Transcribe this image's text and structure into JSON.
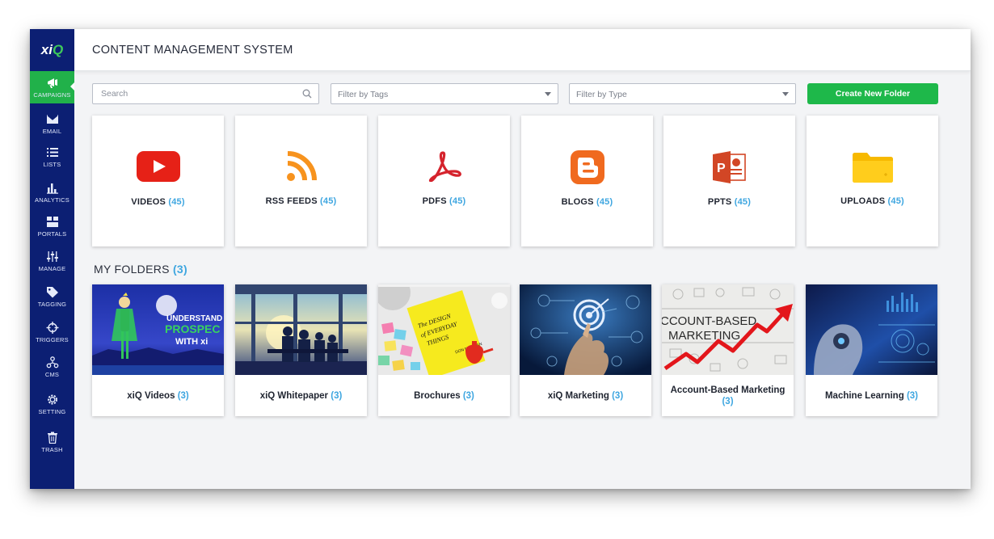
{
  "brand": {
    "logo_main": "xi",
    "logo_accent": "Q",
    "accent_color": "#21b14a",
    "sidebar_color": "#0c1f73"
  },
  "sidebar": {
    "items": [
      {
        "label": "CAMPAIGNS",
        "icon": "megaphone-icon",
        "active": true
      },
      {
        "label": "EMAIL",
        "icon": "envelope-icon"
      },
      {
        "label": "LISTS",
        "icon": "list-icon"
      },
      {
        "label": "ANALYTICS",
        "icon": "bar-chart-icon"
      },
      {
        "label": "PORTALS",
        "icon": "grid-icon"
      },
      {
        "label": "MANAGE",
        "icon": "sliders-icon"
      },
      {
        "label": "TAGGING",
        "icon": "tag-icon"
      },
      {
        "label": "TRIGGERS",
        "icon": "crosshair-icon"
      },
      {
        "label": "CMS",
        "icon": "hierarchy-icon"
      },
      {
        "label": "SETTING",
        "icon": "gear-icon"
      },
      {
        "label": "TRASH",
        "icon": "trash-icon"
      }
    ]
  },
  "header": {
    "title": "CONTENT MANAGEMENT SYSTEM"
  },
  "toolbar": {
    "search_placeholder": "Search",
    "filter_tags": "Filter by Tags",
    "filter_type": "Filter by Type",
    "create_label": "Create New Folder"
  },
  "content_types": [
    {
      "name": "VIDEOS",
      "count": "(45)",
      "icon": "youtube-icon"
    },
    {
      "name": "RSS FEEDS",
      "count": "(45)",
      "icon": "rss-icon"
    },
    {
      "name": "PDFS",
      "count": "(45)",
      "icon": "pdf-icon"
    },
    {
      "name": "BLOGS",
      "count": "(45)",
      "icon": "blogger-icon"
    },
    {
      "name": "PPTS",
      "count": "(45)",
      "icon": "powerpoint-icon"
    },
    {
      "name": "UPLOADS",
      "count": "(45)",
      "icon": "folder-icon"
    }
  ],
  "my_folders": {
    "title": "MY FOLDERS",
    "count": "(3)",
    "folders": [
      {
        "name": "xiQ Videos",
        "count": "(3)",
        "thumb_text_1": "UNDERSTAND YO",
        "thumb_text_2": "PROSPEC",
        "thumb_text_3": "WITH xi"
      },
      {
        "name": "xiQ Whitepaper",
        "count": "(3)"
      },
      {
        "name": "Brochures",
        "count": "(3)",
        "thumb_text_1": "The DESIGN",
        "thumb_text_2": "of EVERYDAY",
        "thumb_text_3": "THINGS",
        "thumb_text_4": "DON NORMAN"
      },
      {
        "name": "xiQ Marketing",
        "count": "(3)"
      },
      {
        "name": "Account-Based Marketing",
        "count": "(3)",
        "thumb_text_1": "CCOUNT-BASED",
        "thumb_text_2": "MARKETING"
      },
      {
        "name": "Machine Learning",
        "count": "(3)"
      }
    ]
  }
}
